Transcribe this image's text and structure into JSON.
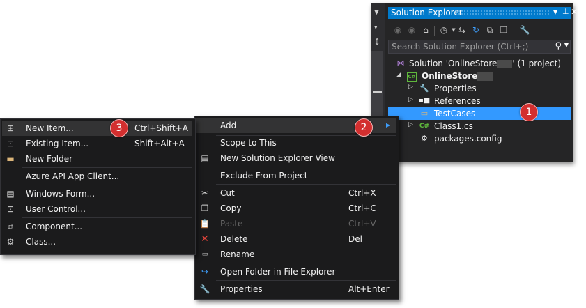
{
  "solution_explorer": {
    "title": "Solution Explorer",
    "title_controls": [
      "▾",
      "ᵽ",
      "✕"
    ],
    "search_placeholder": "Search Solution Explorer (Ctrl+;)",
    "tree": [
      {
        "label": "Solution 'OnlineStore' (1 project)",
        "prefix": "Solution 'OnlineStore",
        "suffix": "' (1 project)"
      },
      {
        "label": "OnlineStore"
      },
      {
        "label": "Properties"
      },
      {
        "label": "References"
      },
      {
        "label": "TestCases"
      },
      {
        "label": "Class1.cs"
      },
      {
        "label": "packages.config"
      }
    ]
  },
  "context_menu": {
    "items": [
      {
        "label": "Add",
        "submenu": true
      },
      {
        "label": "Scope to This"
      },
      {
        "label": "New Solution Explorer View"
      },
      {
        "label": "Exclude From Project"
      },
      {
        "label": "Cut",
        "shortcut": "Ctrl+X"
      },
      {
        "label": "Copy",
        "shortcut": "Ctrl+C"
      },
      {
        "label": "Paste",
        "shortcut": "Ctrl+V",
        "disabled": true
      },
      {
        "label": "Delete",
        "shortcut": "Del"
      },
      {
        "label": "Rename"
      },
      {
        "label": "Open Folder in File Explorer"
      },
      {
        "label": "Properties",
        "shortcut": "Alt+Enter"
      }
    ]
  },
  "add_submenu": {
    "items": [
      {
        "label": "New Item...",
        "shortcut": "Ctrl+Shift+A"
      },
      {
        "label": "Existing Item...",
        "shortcut": "Shift+Alt+A"
      },
      {
        "label": "New Folder"
      },
      {
        "label": "Azure API App Client..."
      },
      {
        "label": "Windows Form..."
      },
      {
        "label": "User Control..."
      },
      {
        "label": "Component..."
      },
      {
        "label": "Class..."
      }
    ]
  },
  "badges": [
    "1",
    "2",
    "3"
  ],
  "colors": {
    "accent": "#007acc",
    "selection": "#3399ff",
    "menu_bg": "#1b1b1c",
    "badge": "#d32f2f"
  }
}
